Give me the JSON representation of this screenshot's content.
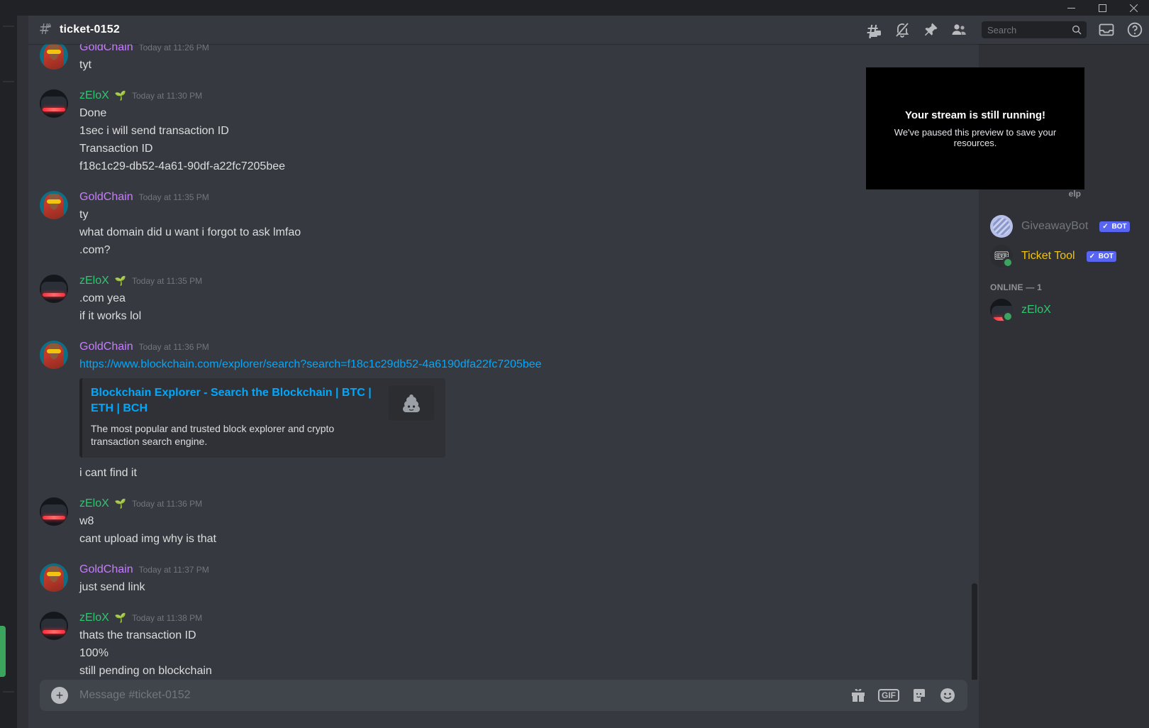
{
  "window": {
    "minimize_label": "Minimize",
    "maximize_label": "Maximize",
    "close_label": "Close"
  },
  "topbar": {
    "channel_name": "ticket-0152",
    "hash_lock_icon": "hash-lock-icon",
    "icons": [
      {
        "name": "threads-icon",
        "label": "Threads"
      },
      {
        "name": "notification-off-icon",
        "label": "Notification Settings"
      },
      {
        "name": "pin-icon",
        "label": "Pinned Messages"
      },
      {
        "name": "members-icon",
        "label": "Member List"
      },
      {
        "name": "inbox-icon",
        "label": "Inbox"
      },
      {
        "name": "help-icon",
        "label": "Help"
      }
    ],
    "search": {
      "placeholder": "Search",
      "value": "",
      "icon": "search-icon"
    }
  },
  "stream_overlay": {
    "title": "Your stream is still running!",
    "subtitle": "We've paused this preview to save your resources."
  },
  "messages": [
    {
      "author": "GoldChain",
      "author_color": "#c77dff",
      "timestamp": "Today at 11:26 PM",
      "badge": "",
      "avatar": "av-gold",
      "lines": [
        "tyt"
      ]
    },
    {
      "author": "zEloX",
      "author_color": "#2dc770",
      "timestamp": "Today at 11:30 PM",
      "badge": "🌱",
      "avatar": "av-zelox",
      "lines": [
        "Done",
        "1sec i will send transaction ID",
        "Transaction ID",
        "f18c1c29-db52-4a61-90df-a22fc7205bee"
      ]
    },
    {
      "author": "GoldChain",
      "author_color": "#c77dff",
      "timestamp": "Today at 11:35 PM",
      "badge": "",
      "avatar": "av-gold",
      "lines": [
        "ty",
        "what domain did u want i forgot to ask lmfao",
        ".com?"
      ]
    },
    {
      "author": "zEloX",
      "author_color": "#2dc770",
      "timestamp": "Today at 11:35 PM",
      "badge": "🌱",
      "avatar": "av-zelox",
      "lines": [
        ".com yea",
        "if it works lol"
      ]
    },
    {
      "author": "GoldChain",
      "author_color": "#c77dff",
      "timestamp": "Today at 11:36 PM",
      "badge": "",
      "avatar": "av-gold",
      "link": "https://www.blockchain.com/explorer/search?search=f18c1c29db52-4a6190dfa22fc7205bee",
      "embed": {
        "title": "Blockchain Explorer - Search the Blockchain | BTC | ETH | BCH",
        "description": "The most popular and trusted block explorer and crypto transaction search engine.",
        "thumbnail_icon": "broken-image-icon"
      },
      "lines_after": [
        "i cant find it"
      ]
    },
    {
      "author": "zEloX",
      "author_color": "#2dc770",
      "timestamp": "Today at 11:36 PM",
      "badge": "🌱",
      "avatar": "av-zelox",
      "lines": [
        "w8",
        "cant upload img why is that"
      ]
    },
    {
      "author": "GoldChain",
      "author_color": "#c77dff",
      "timestamp": "Today at 11:37 PM",
      "badge": "",
      "avatar": "av-gold",
      "lines": [
        "just send link"
      ]
    },
    {
      "author": "zEloX",
      "author_color": "#2dc770",
      "timestamp": "Today at 11:38 PM",
      "badge": "🌱",
      "avatar": "av-zelox",
      "lines": [
        "thats the transaction ID",
        "100%",
        "still pending on blockchain"
      ]
    }
  ],
  "composer": {
    "placeholder": "Message #ticket-0152",
    "value": "",
    "plus_label": "+",
    "gif_label": "GIF",
    "icons": [
      {
        "name": "gift-icon"
      },
      {
        "name": "gif-icon"
      },
      {
        "name": "sticker-icon"
      },
      {
        "name": "emoji-icon"
      }
    ]
  },
  "members": {
    "partial_group_header": "elp",
    "entries": [
      {
        "name": "GiveawayBot",
        "name_color": "#72767d",
        "bot_tag": "BOT",
        "avatar": "av-giveaway",
        "status": "offline"
      },
      {
        "name": "Ticket Tool",
        "name_color": "#f1c40f",
        "bot_tag": "BOT",
        "avatar": "av-tickettool",
        "status": "online"
      }
    ],
    "online_group_header": "ONLINE — 1",
    "online_entries": [
      {
        "name": "zEloX",
        "name_color": "#2dc770",
        "bot_tag": "",
        "avatar": "av-zelox",
        "status": "online"
      }
    ]
  }
}
